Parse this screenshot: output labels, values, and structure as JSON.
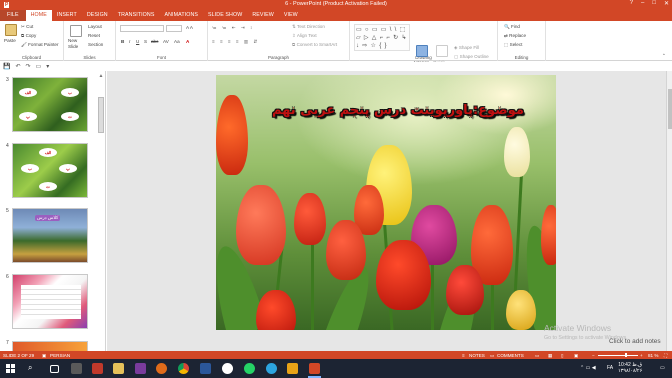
{
  "window": {
    "title": "6 - PowerPoint (Product Activation Failed)",
    "help": "?",
    "minimize": "–",
    "maximize": "□",
    "close": "✕"
  },
  "qat": {
    "save": "💾",
    "undo": "↶",
    "redo": "↷",
    "start": "▭",
    "more": "▾"
  },
  "tabs": [
    {
      "label": "FILE"
    },
    {
      "label": "HOME"
    },
    {
      "label": "INSERT"
    },
    {
      "label": "DESIGN"
    },
    {
      "label": "TRANSITIONS"
    },
    {
      "label": "ANIMATIONS"
    },
    {
      "label": "SLIDE SHOW"
    },
    {
      "label": "REVIEW"
    },
    {
      "label": "VIEW"
    }
  ],
  "ribbon": {
    "clipboard": {
      "group": "Clipboard",
      "paste": "Paste",
      "cut": "Cut",
      "copy": "Copy",
      "format_painter": "Format Painter"
    },
    "slides": {
      "group": "Slides",
      "new_slide": "New Slide",
      "layout": "Layout",
      "reset": "Reset",
      "section": "Section"
    },
    "font": {
      "group": "Font",
      "bold": "B",
      "italic": "I",
      "underline": "U",
      "shadow": "S",
      "strike": "abc",
      "spacing": "AV",
      "case": "Aa",
      "color": "A"
    },
    "paragraph": {
      "group": "Paragraph",
      "text_direction": "Text Direction",
      "align_text": "Align Text",
      "smartart": "Convert to SmartArt"
    },
    "drawing": {
      "group": "Drawing",
      "arrange": "Arrange",
      "quick_styles": "Quick Styles",
      "shape_fill": "Shape Fill",
      "shape_outline": "Shape Outline",
      "shape_effects": "Shape Effects",
      "shapes": "▭ ○ ▭ ▭ \\ \\ ⬚ ▱ ▷ △ ⌐ ⌐ ↻ ↳ ↓ ⇨ ☆ { }"
    },
    "editing": {
      "group": "Editing",
      "find": "Find",
      "replace": "Replace",
      "select": "Select"
    }
  },
  "thumbnails": [
    {
      "number": "3",
      "clouds": [
        "الف",
        "ب",
        "پ",
        "ت"
      ]
    },
    {
      "number": "4",
      "clouds": [
        "الف",
        "ب",
        "پ",
        "ت"
      ]
    },
    {
      "number": "5",
      "caption": "كلاس درس"
    },
    {
      "number": "6"
    },
    {
      "number": "7"
    }
  ],
  "slide": {
    "title": "موضوع:پاورپوینت درس پنجم عربی نهم"
  },
  "overlay": {
    "activate": "Activate Windows",
    "activate_sub": "Go to Settings to activate Windows.",
    "click_notes": "Click to add notes"
  },
  "status": {
    "slide_of": "SLIDE 2 OF 29",
    "language": "PERSIAN",
    "notes": "NOTES",
    "comments": "COMMENTS",
    "zoom": "81 %",
    "zoom_minus": "−",
    "zoom_plus": "+"
  },
  "taskbar": {
    "time": "10:42 ق.ظ",
    "date": "۱۳۹۸/۰۸/۲۶",
    "lang": "FA"
  },
  "colors": {
    "accent": "#d24726",
    "title_red": "#c01010"
  }
}
